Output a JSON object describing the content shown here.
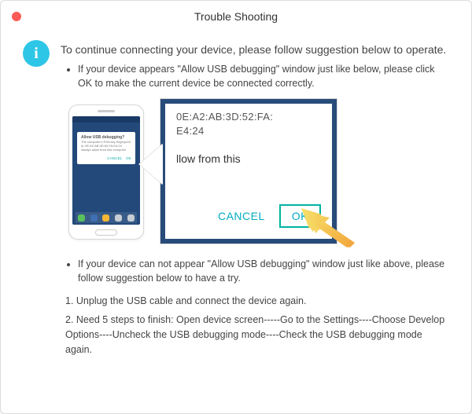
{
  "titlebar": {
    "title": "Trouble Shooting"
  },
  "info_icon_glyph": "i",
  "heading": "To continue connecting your device, please follow suggestion below to operate.",
  "bullets": {
    "b1": "If your device appears \"Allow USB debugging\" window just like below, please click OK to make the current device  be connected correctly.",
    "b2": "If your device can not appear \"Allow USB debugging\" window just like above, please follow suggestion below to have a try."
  },
  "steps": {
    "s1": "1. Unplug the USB cable and connect the device again.",
    "s2": "2. Need 5 steps to finish: Open device screen-----Go to the Settings----Choose Develop Options----Uncheck the USB debugging mode----Check the USB debugging mode again."
  },
  "dialog": {
    "mini_title": "Allow USB debugging?",
    "mini_body": "The computer's RSA key fingerprint is: 0E:A2:AB:3D:52:FA:E4:24",
    "mini_always": "Always allow from this computer",
    "mac_line1": "0E:A2:AB:3D:52:FA:",
    "mac_line2": "E4:24",
    "allow_text": "llow from this",
    "cancel": "CANCEL",
    "ok": "OK"
  }
}
